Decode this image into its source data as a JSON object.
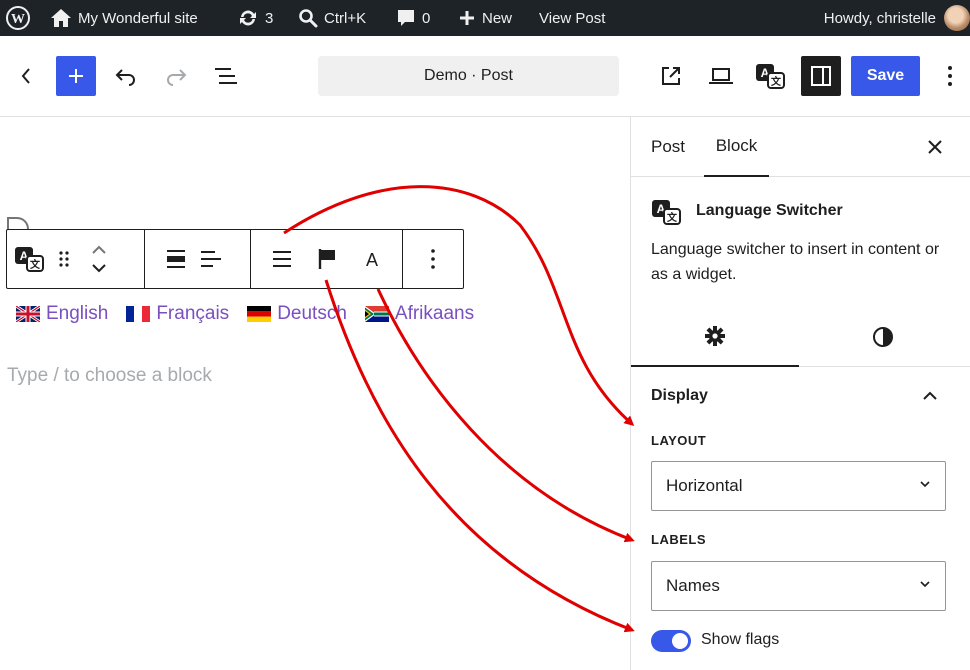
{
  "admin_bar": {
    "site_name": "My Wonderful site",
    "updates_count": "3",
    "search_shortcut": "Ctrl+K",
    "comments_count": "0",
    "new_label": "New",
    "view_post_label": "View Post",
    "greeting": "Howdy, christelle"
  },
  "header": {
    "document_title": "Demo · Post",
    "save_label": "Save"
  },
  "canvas": {
    "languages": [
      {
        "label": "English",
        "flag": "uk-flag"
      },
      {
        "label": "Français",
        "flag": "france-flag"
      },
      {
        "label": "Deutsch",
        "flag": "germany-flag"
      },
      {
        "label": "Afrikaans",
        "flag": "south-africa-flag"
      }
    ],
    "placeholder": "Type / to choose a block"
  },
  "sidebar": {
    "tabs": [
      {
        "label": "Post"
      },
      {
        "label": "Block"
      }
    ],
    "active_tab": "Block",
    "block": {
      "title": "Language Switcher",
      "description": "Language switcher to insert in content or as a widget."
    },
    "panel": {
      "title": "Display",
      "layout_label": "LAYOUT",
      "layout_value": "Horizontal",
      "labels_label": "LABELS",
      "labels_value": "Names",
      "show_flags_label": "Show flags",
      "show_flags": true
    }
  },
  "colors": {
    "admin_bar": "#1d2327",
    "accent": "#3858e9",
    "link": "#7a4fbf",
    "annotation_arrow": "#e00000"
  }
}
